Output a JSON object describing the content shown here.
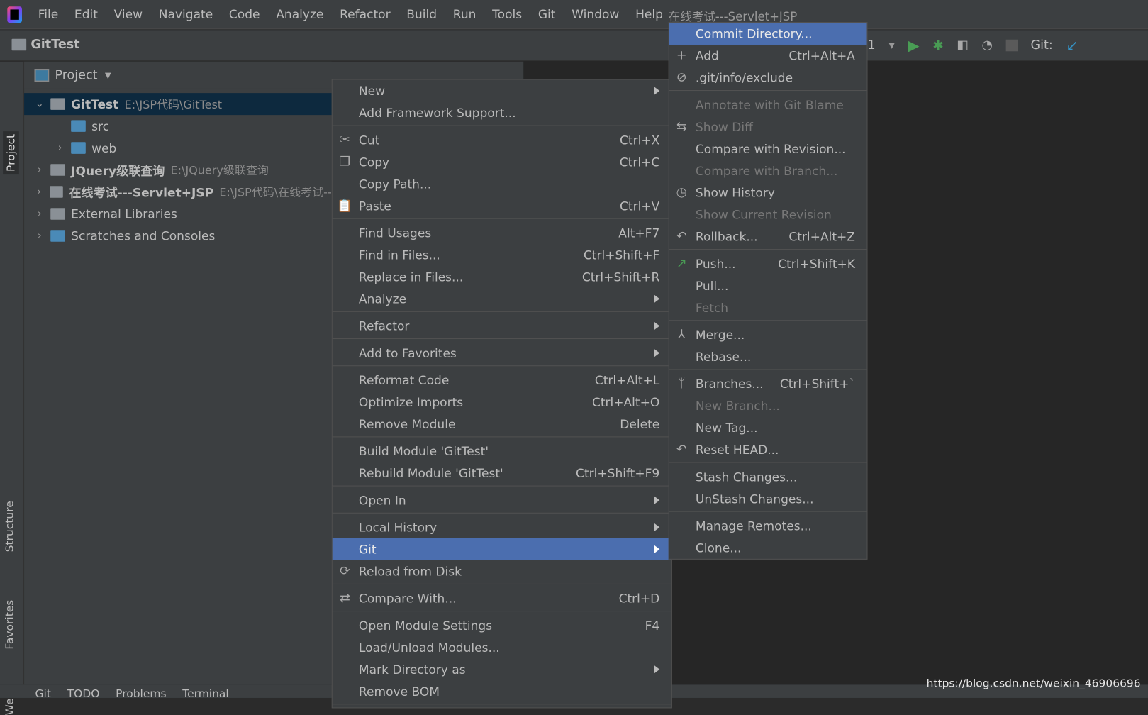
{
  "menubar": {
    "items": [
      "File",
      "Edit",
      "View",
      "Navigate",
      "Code",
      "Analyze",
      "Refactor",
      "Build",
      "Run",
      "Tools",
      "Git",
      "Window",
      "Help"
    ],
    "window_title": "在线考试---Servlet+JSP"
  },
  "toolbar": {
    "project": "GitTest",
    "config_suffix": "1",
    "git_label": "Git:"
  },
  "stripe": {
    "project": "Project",
    "structure": "Structure",
    "favorites": "Favorites",
    "web": "Web"
  },
  "panel": {
    "title": "Project",
    "tree": [
      {
        "label": "GitTest",
        "path": "E:\\JSP代码\\GitTest",
        "bold": true
      },
      {
        "label": "src",
        "path": ""
      },
      {
        "label": "web",
        "path": ""
      },
      {
        "label": "JQuery级联查询",
        "path": "E:\\JQuery级联查询",
        "bold": true
      },
      {
        "label": "在线考试---Servlet+JSP",
        "path": "E:\\JSP代码\\在线考试--",
        "bold": true
      },
      {
        "label": "External Libraries",
        "path": ""
      },
      {
        "label": "Scratches and Consoles",
        "path": ""
      }
    ]
  },
  "context_menu": [
    {
      "label": "New",
      "submenu": true
    },
    {
      "label": "Add Framework Support..."
    },
    {
      "sep": true
    },
    {
      "label": "Cut",
      "shortcut": "Ctrl+X",
      "icon": "scissors"
    },
    {
      "label": "Copy",
      "shortcut": "Ctrl+C",
      "icon": "copy"
    },
    {
      "label": "Copy Path..."
    },
    {
      "label": "Paste",
      "shortcut": "Ctrl+V",
      "icon": "clipboard"
    },
    {
      "sep": true
    },
    {
      "label": "Find Usages",
      "shortcut": "Alt+F7"
    },
    {
      "label": "Find in Files...",
      "shortcut": "Ctrl+Shift+F"
    },
    {
      "label": "Replace in Files...",
      "shortcut": "Ctrl+Shift+R"
    },
    {
      "label": "Analyze",
      "submenu": true
    },
    {
      "sep": true
    },
    {
      "label": "Refactor",
      "submenu": true
    },
    {
      "sep": true
    },
    {
      "label": "Add to Favorites",
      "submenu": true
    },
    {
      "sep": true
    },
    {
      "label": "Reformat Code",
      "shortcut": "Ctrl+Alt+L"
    },
    {
      "label": "Optimize Imports",
      "shortcut": "Ctrl+Alt+O"
    },
    {
      "label": "Remove Module",
      "shortcut": "Delete"
    },
    {
      "sep": true
    },
    {
      "label": "Build Module 'GitTest'"
    },
    {
      "label": "Rebuild Module 'GitTest'",
      "shortcut": "Ctrl+Shift+F9"
    },
    {
      "sep": true
    },
    {
      "label": "Open In",
      "submenu": true
    },
    {
      "sep": true
    },
    {
      "label": "Local History",
      "submenu": true
    },
    {
      "label": "Git",
      "submenu": true,
      "highlighted": true
    },
    {
      "label": "Reload from Disk",
      "icon": "reload"
    },
    {
      "sep": true
    },
    {
      "label": "Compare With...",
      "shortcut": "Ctrl+D",
      "icon": "compare"
    },
    {
      "sep": true
    },
    {
      "label": "Open Module Settings",
      "shortcut": "F4"
    },
    {
      "label": "Load/Unload Modules..."
    },
    {
      "label": "Mark Directory as",
      "submenu": true
    },
    {
      "label": "Remove BOM"
    },
    {
      "sep": true
    }
  ],
  "git_menu": [
    {
      "label": "Commit Directory...",
      "highlighted": true
    },
    {
      "label": "Add",
      "shortcut": "Ctrl+Alt+A",
      "icon": "plus"
    },
    {
      "label": ".git/info/exclude",
      "icon": "file-ignore"
    },
    {
      "sep": true
    },
    {
      "label": "Annotate with Git Blame",
      "disabled": true
    },
    {
      "label": "Show Diff",
      "disabled": true,
      "icon": "diff"
    },
    {
      "label": "Compare with Revision..."
    },
    {
      "label": "Compare with Branch...",
      "disabled": true
    },
    {
      "label": "Show History",
      "icon": "clock"
    },
    {
      "label": "Show Current Revision",
      "disabled": true
    },
    {
      "label": "Rollback...",
      "shortcut": "Ctrl+Alt+Z",
      "icon": "undo"
    },
    {
      "sep": true
    },
    {
      "label": "Push...",
      "shortcut": "Ctrl+Shift+K",
      "icon": "push"
    },
    {
      "label": "Pull..."
    },
    {
      "label": "Fetch",
      "disabled": true
    },
    {
      "sep": true
    },
    {
      "label": "Merge...",
      "icon": "merge"
    },
    {
      "label": "Rebase..."
    },
    {
      "sep": true
    },
    {
      "label": "Branches...",
      "shortcut": "Ctrl+Shift+`",
      "icon": "branch"
    },
    {
      "label": "New Branch...",
      "disabled": true
    },
    {
      "label": "New Tag..."
    },
    {
      "label": "Reset HEAD...",
      "icon": "undo"
    },
    {
      "sep": true
    },
    {
      "label": "Stash Changes..."
    },
    {
      "label": "UnStash Changes..."
    },
    {
      "sep": true
    },
    {
      "label": "Manage Remotes..."
    },
    {
      "label": "Clone..."
    }
  ],
  "status_bar": {
    "tabs": [
      "Git",
      "TODO",
      "Problems",
      "Terminal"
    ]
  },
  "watermark": "https://blog.csdn.net/weixin_46906696",
  "colors": {
    "highlight": "#4b6eaf",
    "menu_bg": "#3c3f41",
    "selection": "#0d293e",
    "run_green": "#499c54"
  }
}
